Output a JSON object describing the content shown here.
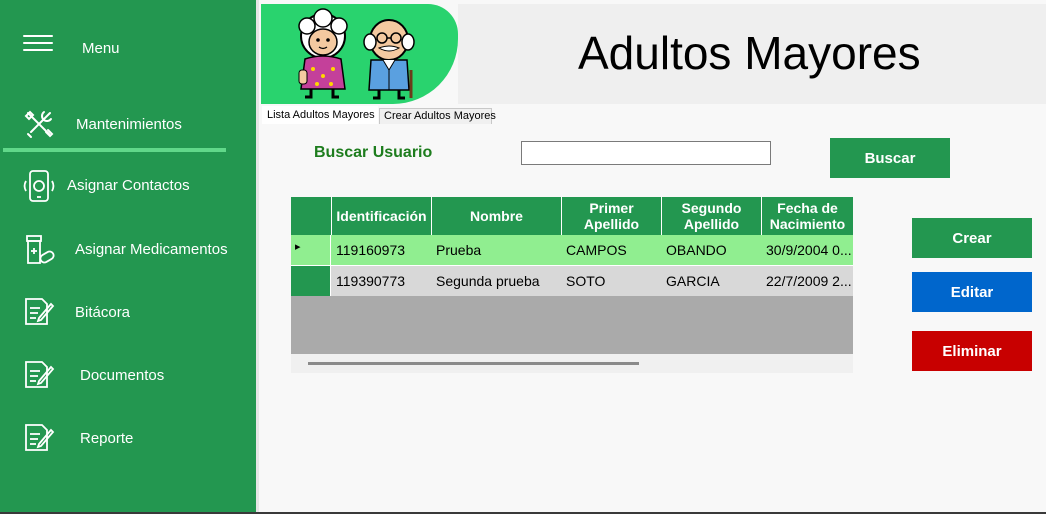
{
  "sidebar": {
    "menu_label": "Menu",
    "items": [
      {
        "label": "Mantenimientos",
        "icon": "tools-icon"
      },
      {
        "label": "Asignar Contactos",
        "icon": "phone-contact-icon"
      },
      {
        "label": "Asignar Medicamentos",
        "icon": "medicine-icon"
      },
      {
        "label": "Bitácora",
        "icon": "document-edit-icon"
      },
      {
        "label": "Documentos",
        "icon": "document-edit-icon"
      },
      {
        "label": "Reporte",
        "icon": "document-edit-icon"
      }
    ]
  },
  "header": {
    "title": "Adultos Mayores",
    "logo": "elderly-couple-logo"
  },
  "tabs": [
    "Lista Adultos Mayores",
    "Crear Adultos Mayores"
  ],
  "search": {
    "label": "Buscar Usuario",
    "value": "",
    "button": "Buscar"
  },
  "actions": {
    "create": "Crear",
    "edit": "Editar",
    "delete": "Eliminar"
  },
  "table": {
    "columns": [
      "Identificación",
      "Nombre",
      "Primer Apellido",
      "Segundo Apellido",
      "Fecha de Nacimiento"
    ],
    "rows": [
      [
        "119160973",
        "Prueba",
        "CAMPOS",
        "OBANDO",
        "30/9/2004 0..."
      ],
      [
        "119390773",
        "Segunda prueba",
        "SOTO",
        "GARCIA",
        "22/7/2009 2..."
      ]
    ],
    "selected_row_marker": "▸"
  },
  "colors": {
    "sidebar": "#239750",
    "selected_row": "#90ee90",
    "row": "#d8d8d8",
    "create_button": "#239750",
    "edit_button": "#0066cc",
    "delete_button": "#c80000",
    "search_label": "#1e7d1e"
  }
}
